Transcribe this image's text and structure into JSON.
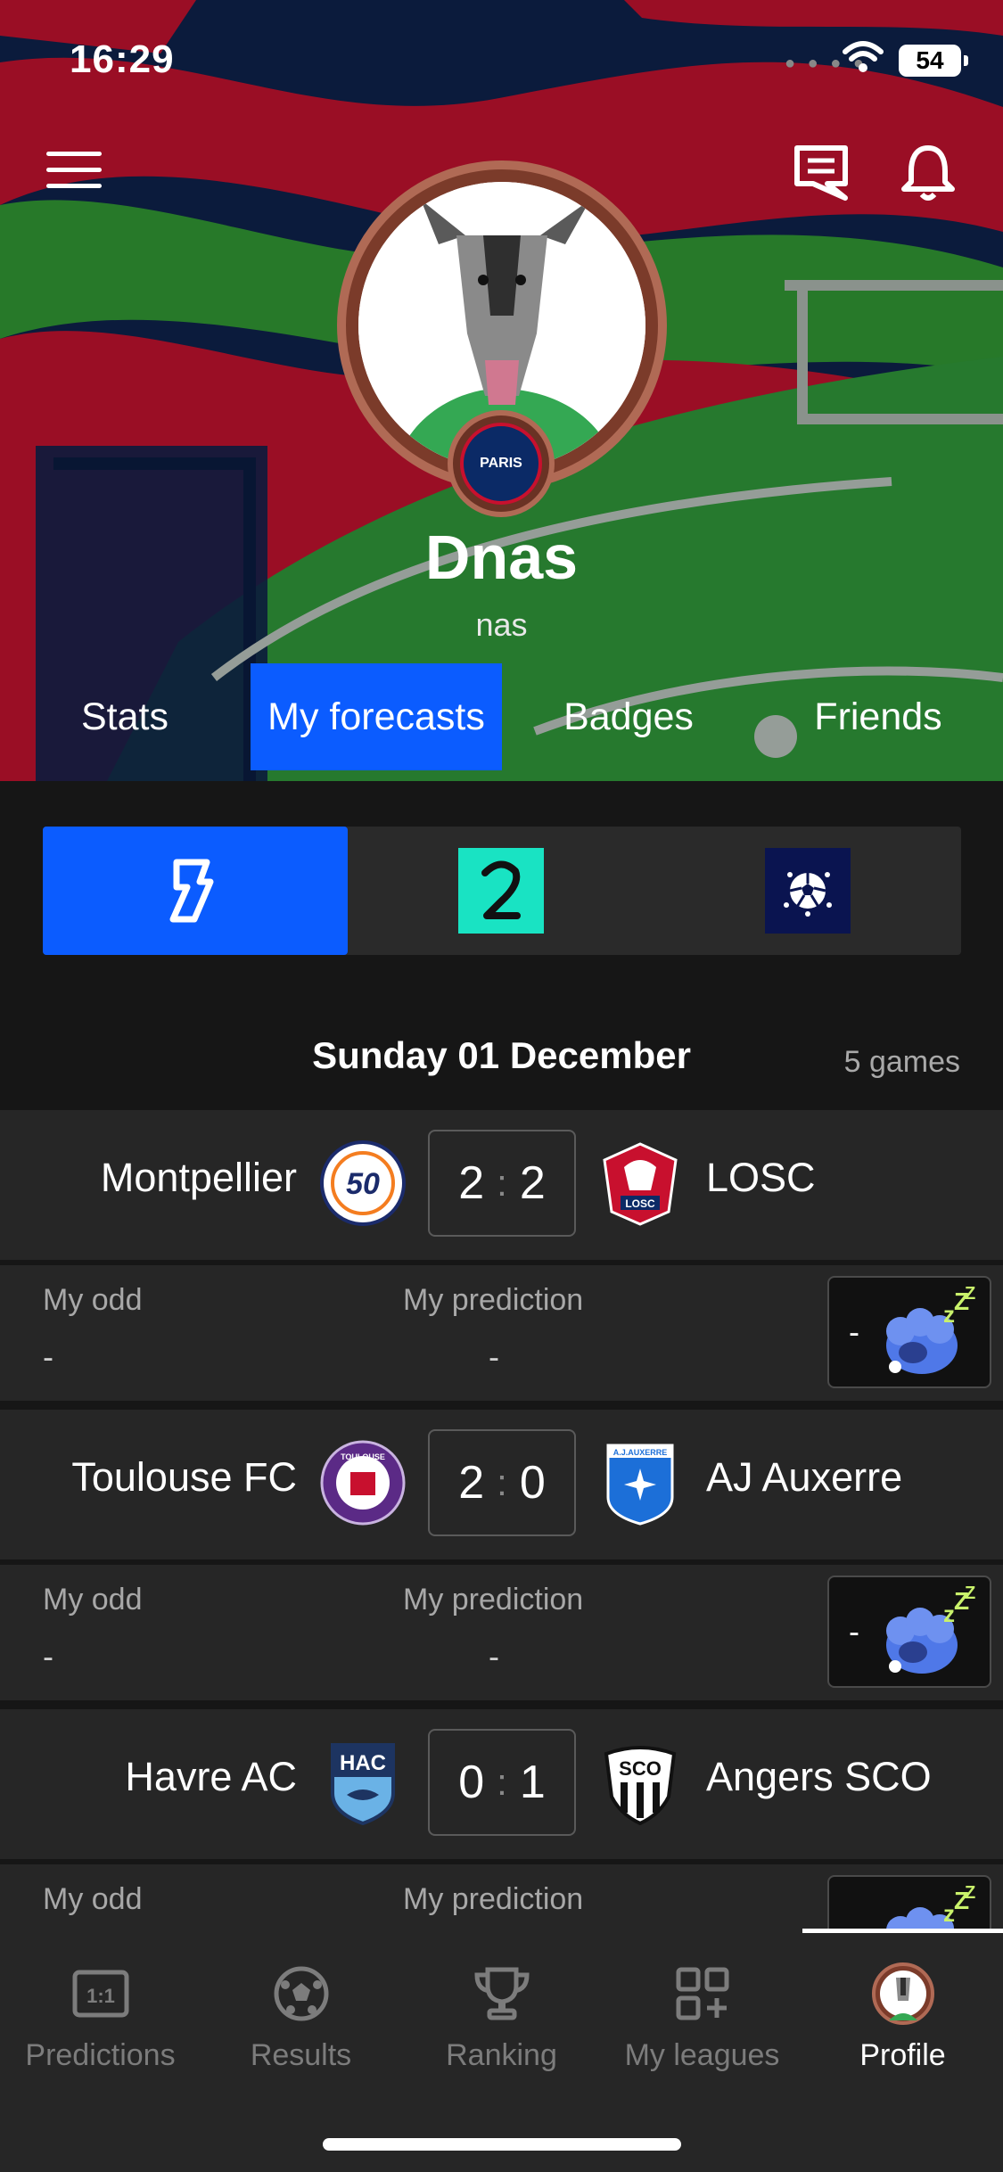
{
  "status_bar": {
    "time": "16:29",
    "battery": "54"
  },
  "profile": {
    "name": "Dnas",
    "handle": "nas",
    "club_badge_text": "PARIS"
  },
  "tabs": [
    {
      "label": "Stats"
    },
    {
      "label": "My forecasts"
    },
    {
      "label": "Badges"
    },
    {
      "label": "Friends"
    }
  ],
  "active_tab": "My forecasts",
  "leagues": [
    {
      "name": "Ligue 1",
      "logo_text": "1",
      "active": true
    },
    {
      "name": "Ligue 2",
      "logo_text": "2",
      "active": false
    },
    {
      "name": "Champions League",
      "logo_text": "⚽",
      "active": false
    }
  ],
  "day": {
    "title": "Sunday 01 December",
    "games_count": "5 games"
  },
  "labels": {
    "my_odd": "My odd",
    "my_prediction": "My prediction",
    "dash": "-"
  },
  "matches": [
    {
      "home": "Montpellier",
      "away": "LOSC",
      "home_score": "2",
      "away_score": "2",
      "my_odd": "-",
      "my_prediction": "-",
      "status_value": "-"
    },
    {
      "home": "Toulouse FC",
      "away": "AJ Auxerre",
      "home_score": "2",
      "away_score": "0",
      "my_odd": "-",
      "my_prediction": "-",
      "status_value": "-"
    },
    {
      "home": "Havre AC",
      "away": "Angers SCO",
      "home_score": "0",
      "away_score": "1",
      "my_odd": "-",
      "my_prediction": "-",
      "status_value": "-"
    }
  ],
  "crests": {
    "montpellier": "50",
    "losc": "LOSC",
    "toulouse": "TOULOUSE",
    "auxerre": "A.J.AUXERRE",
    "hac": "HAC",
    "sco": "SCO"
  },
  "tabbar": [
    {
      "label": "Predictions",
      "icon": "one-to-one-icon"
    },
    {
      "label": "Results",
      "icon": "football-icon"
    },
    {
      "label": "Ranking",
      "icon": "trophy-icon"
    },
    {
      "label": "My leagues",
      "icon": "grid-plus-icon"
    },
    {
      "label": "Profile",
      "icon": "avatar-icon",
      "active": true
    }
  ],
  "colors": {
    "accent": "#0b5cff",
    "background": "#161616",
    "card": "#262626",
    "psg_red": "#c8102e",
    "psg_navy": "#0b2a66"
  }
}
